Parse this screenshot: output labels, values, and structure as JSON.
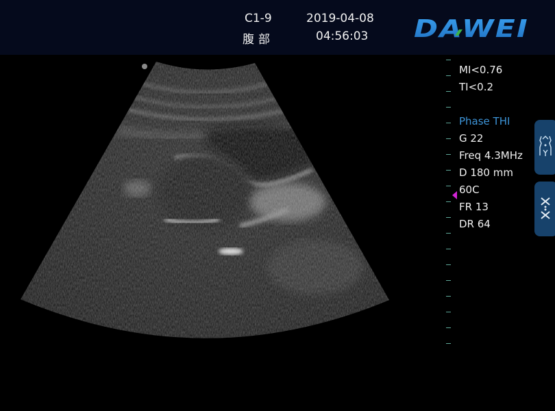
{
  "header": {
    "probe": "C1-9",
    "preset": "腹部",
    "date": "2019-04-08",
    "time": "04:56:03",
    "brand": "DAWEI",
    "brand_colors": {
      "primary": "#2f8fe0",
      "accent": "#3cb34a"
    },
    "background": "#050a1c"
  },
  "image": {
    "mode": "B-mode sector scan",
    "orientation_marker": "dot",
    "depth_scale": {
      "tick_count": 19,
      "tick_color": "#5fa99a"
    },
    "focus_marker_color": "#d324d6"
  },
  "parameters": {
    "mi": "MI<0.76",
    "ti": "TI<0.2",
    "mode": "Phase THI",
    "gain": "G 22",
    "freq": "Freq 4.3MHz",
    "depth": "D 180 mm",
    "map": "60C",
    "frame_rate": "FR 13",
    "dynamic_range": "DR 64",
    "mode_color": "#3d94d8"
  },
  "side_buttons": [
    {
      "name": "body-mark",
      "icon": "body-mark-icon"
    },
    {
      "name": "measure",
      "icon": "measure-icon"
    }
  ]
}
